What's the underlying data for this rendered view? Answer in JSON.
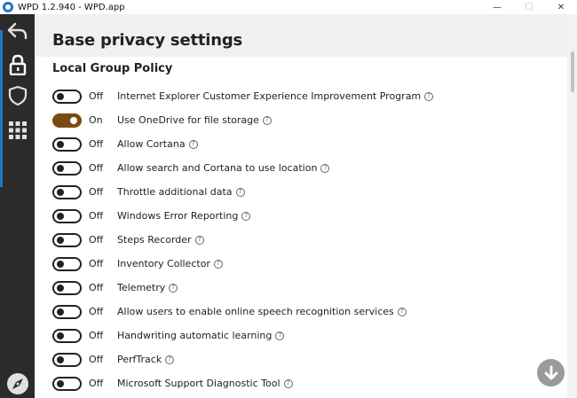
{
  "window": {
    "title": "WPD 1.2.940 - WPD.app",
    "controls": {
      "minimize": "—",
      "maximize": "☐",
      "close": "✕"
    }
  },
  "sidebar": {
    "items": [
      {
        "icon": "back-arrow-icon",
        "active": false
      },
      {
        "icon": "lock-icon",
        "active": true
      },
      {
        "icon": "shield-icon",
        "active": false
      },
      {
        "icon": "grid-icon",
        "active": false
      }
    ],
    "bottom_icon": "compass-icon",
    "accent_color": "#1e78c8"
  },
  "header": {
    "title": "Base privacy settings"
  },
  "section": {
    "title": "Local Group Policy"
  },
  "toggle_colors": {
    "on": "#7a4a12",
    "off": "#222222"
  },
  "settings": [
    {
      "state": "Off",
      "label": "Internet Explorer Customer Experience Improvement Program",
      "on": false
    },
    {
      "state": "On",
      "label": "Use OneDrive for file storage",
      "on": true
    },
    {
      "state": "Off",
      "label": "Allow Cortana",
      "on": false
    },
    {
      "state": "Off",
      "label": "Allow search and Cortana to use location",
      "on": false
    },
    {
      "state": "Off",
      "label": "Throttle additional data",
      "on": false
    },
    {
      "state": "Off",
      "label": "Windows Error Reporting",
      "on": false
    },
    {
      "state": "Off",
      "label": "Steps Recorder",
      "on": false
    },
    {
      "state": "Off",
      "label": "Inventory Collector",
      "on": false
    },
    {
      "state": "Off",
      "label": "Telemetry",
      "on": false
    },
    {
      "state": "Off",
      "label": "Allow users to enable online speech recognition services",
      "on": false
    },
    {
      "state": "Off",
      "label": "Handwriting automatic learning",
      "on": false
    },
    {
      "state": "Off",
      "label": "PerfTrack",
      "on": false
    },
    {
      "state": "Off",
      "label": "Microsoft Support Diagnostic Tool",
      "on": false
    }
  ],
  "fab": {
    "icon": "arrow-down-icon"
  }
}
